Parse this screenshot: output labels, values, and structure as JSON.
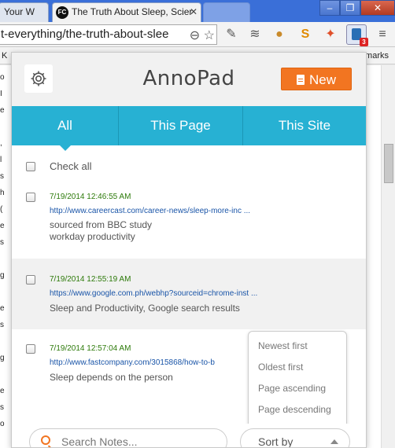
{
  "browser": {
    "tabs": [
      {
        "title": "Your W"
      },
      {
        "title": "The Truth About Sleep, Scier",
        "favicon": "FC"
      },
      {
        "title": ""
      }
    ],
    "address": "t-everything/the-truth-about-slee",
    "bookmarks_label": "marks",
    "bookmarks_left": "K"
  },
  "page_edge_letters": [
    "o",
    "I",
    "e",
    "",
    ",",
    "l",
    "s",
    "h",
    "(",
    "e",
    "s",
    "",
    "g",
    "",
    "e",
    "s",
    "",
    "g",
    "",
    "e",
    "s",
    "o"
  ],
  "popup": {
    "title": "AnnoPad",
    "new_button": "New",
    "tabs": [
      {
        "label": "All",
        "active": true
      },
      {
        "label": "This Page",
        "active": false
      },
      {
        "label": "This Site",
        "active": false
      }
    ],
    "check_all": "Check all",
    "notes": [
      {
        "timestamp": "7/19/2014 12:46:55 AM",
        "url": "http://www.careercast.com/career-news/sleep-more-inc ...",
        "text": "sourced from BBC study\nworkday productivity"
      },
      {
        "timestamp": "7/19/2014 12:55:19 AM",
        "url": "https://www.google.com.ph/webhp?sourceid=chrome-inst ...",
        "text": "Sleep and Productivity, Google search results"
      },
      {
        "timestamp": "7/19/2014 12:57:04 AM",
        "url": "http://www.fastcompany.com/3015868/how-to-b",
        "text": "Sleep depends on the person"
      }
    ],
    "sort_options": [
      "Newest first",
      "Oldest first",
      "Page ascending",
      "Page descending"
    ],
    "search_placeholder": "Search Notes...",
    "sort_label": "Sort by"
  },
  "colors": {
    "accent_orange": "#f27521",
    "tab_bar_blue": "#27b1d3",
    "timestamp_green": "#2d7a0a",
    "link_blue": "#1a55a8"
  }
}
